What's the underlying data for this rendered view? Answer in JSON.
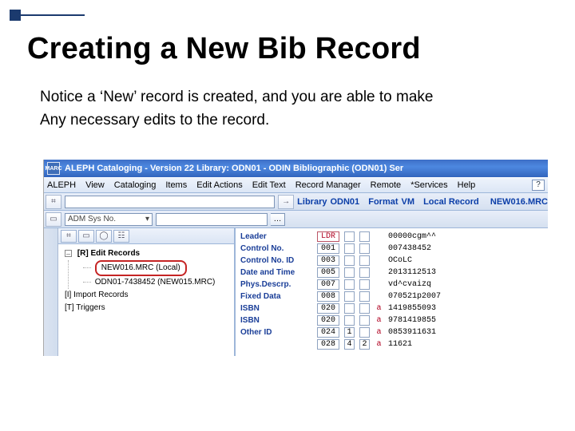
{
  "slide": {
    "title": "Creating a New Bib Record",
    "body_line1": "Notice a ‘New’ record is created, and you are able to make",
    "body_line2": "Any necessary edits to the record."
  },
  "titlebar": {
    "app_icon_text": "MARC",
    "text": "ALEPH Cataloging - Version 22  Library: ODN01 - ODIN Bibliographic (ODN01)  Ser"
  },
  "menus": [
    "ALEPH",
    "View",
    "Cataloging",
    "Items",
    "Edit Actions",
    "Edit Text",
    "Record Manager",
    "Remote",
    "*Services",
    "Help"
  ],
  "help_q": "?",
  "row2": {
    "arrow": "→",
    "info_parts": {
      "library_label": "Library",
      "library_val": "ODN01",
      "format_label": "Format",
      "format_val": "VM",
      "local_label": "Local Record",
      "file": "NEW016.MRC"
    }
  },
  "row3": {
    "combo_text": "ADM Sys No.",
    "caret": "▾",
    "dots": "…"
  },
  "sidebar": {
    "root_label": "[R] Edit Records",
    "items": [
      "NEW016.MRC (Local)",
      "ODN01-7438452 (NEW015.MRC)"
    ],
    "import_label": "[I] Import Records",
    "triggers_label": "[T] Triggers"
  },
  "editor_rows": [
    {
      "label": "Leader",
      "tag": "LDR",
      "tag_red": true,
      "i1": "",
      "i2": "",
      "sf": "",
      "val": "00000cgm^^"
    },
    {
      "label": "Control No.",
      "tag": "001",
      "i1": "",
      "i2": "",
      "sf": "",
      "val": "007438452"
    },
    {
      "label": "Control No. ID",
      "tag": "003",
      "i1": "",
      "i2": "",
      "sf": "",
      "val": "OCoLC"
    },
    {
      "label": "Date and Time",
      "tag": "005",
      "i1": "",
      "i2": "",
      "sf": "",
      "val": "2013112513"
    },
    {
      "label": "Phys.Descrp.",
      "tag": "007",
      "i1": "",
      "i2": "",
      "sf": "",
      "val": "vd^cvaizq"
    },
    {
      "label": "Fixed Data",
      "tag": "008",
      "i1": "",
      "i2": "",
      "sf": "",
      "val": "070521p2007"
    },
    {
      "label": "ISBN",
      "tag": "020",
      "i1": "",
      "i2": "",
      "sf": "a",
      "val": "1419855093"
    },
    {
      "label": "ISBN",
      "tag": "020",
      "i1": "",
      "i2": "",
      "sf": "a",
      "val": "9781419855"
    },
    {
      "label": "Other ID",
      "tag": "024",
      "i1": "1",
      "i2": "",
      "sf": "a",
      "val": "0853911631"
    },
    {
      "label": "",
      "tag": "028",
      "i1": "4",
      "i2": "2",
      "sf": "a",
      "val": "11621"
    }
  ]
}
